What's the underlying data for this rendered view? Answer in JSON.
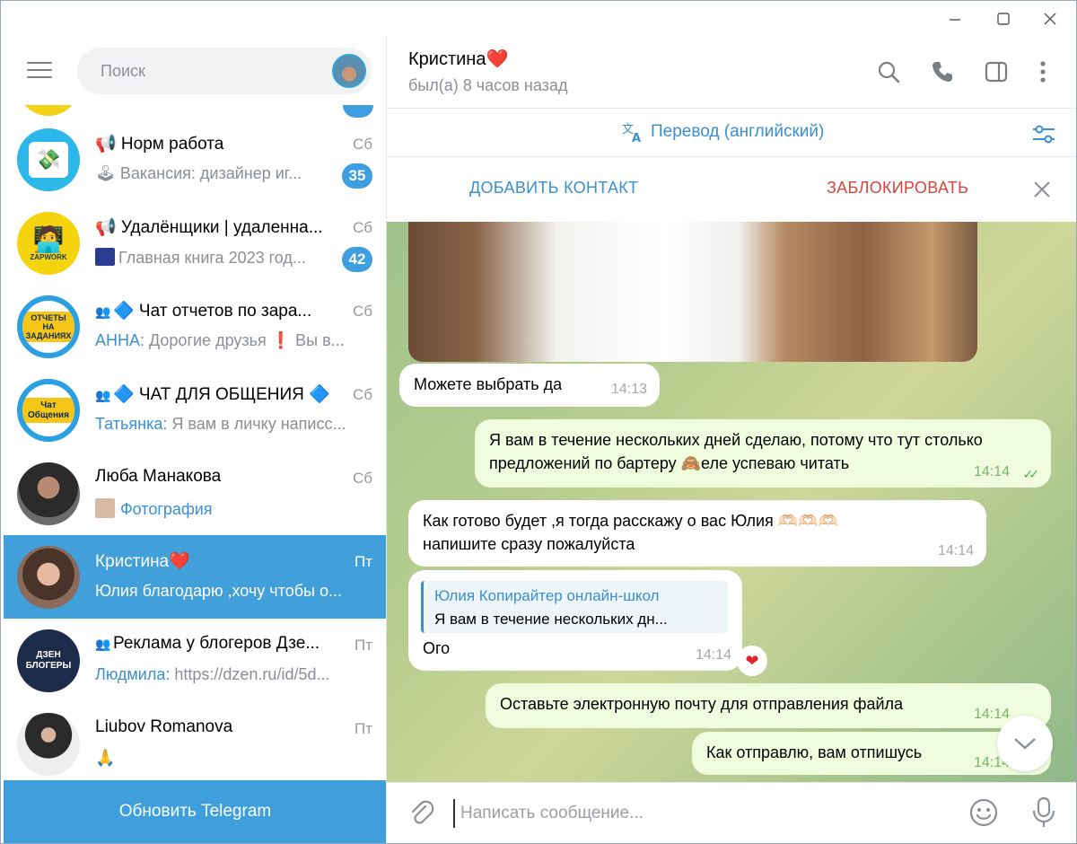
{
  "sidebar": {
    "search_placeholder": "Поиск",
    "chats": [
      {
        "title": "📢 Норм работа",
        "date": "Сб",
        "preview": "🕹 Вакансия: дизайнер иг...",
        "unread": "35"
      },
      {
        "title": "📢 Удалёнщики | удаленна...",
        "date": "Сб",
        "preview": "Главная книга 2023 год...",
        "unread": "42",
        "avatar_text": "ZAPWORK"
      },
      {
        "title": "🔷 Чат отчетов по зара...",
        "date": "Сб",
        "preview_author": "АННА:",
        "preview": " Дорогие друзья ❗ Вы в...",
        "avatar_text": "ОТЧЕТЫ НА ЗАДАНИЯХ"
      },
      {
        "title": "🔷 ЧАТ ДЛЯ ОБЩЕНИЯ 🔷",
        "date": "Сб",
        "preview_author": "Татьянка:",
        "preview": " Я вам в личку написс...",
        "avatar_text": "Чат Общения"
      },
      {
        "title": "Люба Манакова",
        "date": "Сб",
        "preview": "Фотография"
      },
      {
        "title": "Кристина❤️",
        "date": "Пт",
        "preview": "Юлия благодарю ,хочу чтобы о..."
      },
      {
        "title": "Реклама у блогеров Дзе...",
        "date": "Пт",
        "preview_author": "Людмила:",
        "preview": " https://dzen.ru/id/5d...",
        "avatar_text": "ДЗЕН БЛОГЕРЫ"
      },
      {
        "title": "Liubov Romanova",
        "date": "Пт",
        "preview": "🙏"
      }
    ],
    "update_button": "Обновить Telegram"
  },
  "chat": {
    "peer_name": "Кристина❤️",
    "peer_status": "был(а) 8 часов назад",
    "translate_label": "Перевод (английский)",
    "add_contact": "ДОБАВИТЬ КОНТАКТ",
    "block": "ЗАБЛОКИРОВАТЬ",
    "messages": [
      {
        "text": "Можете выбрать да",
        "time": "14:13"
      },
      {
        "text1": "Я вам в течение нескольких дней сделаю, потому что тут столько",
        "text2": "предложений по бартеру 🙈еле успеваю читать",
        "time": "14:14"
      },
      {
        "text1": "Как готово будет ,я тогда расскажу о вас Юлия 🫶🏻🫶🏻🫶🏻",
        "text2": "напишите сразу пожалуйста",
        "time": "14:14"
      },
      {
        "reply_author": "Юлия Копирайтер онлайн-школ",
        "reply_text": "Я вам в течение нескольких дн...",
        "text": "Ого",
        "time": "14:14",
        "reaction": "❤"
      },
      {
        "text": "Оставьте электронную почту для отправления файла",
        "time": "14:14"
      },
      {
        "text": "Как отправлю, вам отпишусь",
        "time": "14:14"
      }
    ],
    "composer_placeholder": "Написать сообщение..."
  }
}
